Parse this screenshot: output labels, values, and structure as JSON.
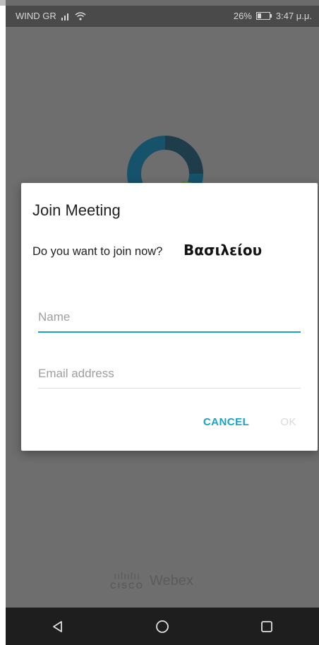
{
  "status_bar": {
    "carrier": "WIND GR",
    "battery": "26%",
    "time": "3:47 μ.μ."
  },
  "dialog": {
    "title": "Join Meeting",
    "message": "Do you want to join now?",
    "meeting_name": "Βασιλείου",
    "name_placeholder": "Name",
    "email_placeholder": "Email address",
    "cancel_label": "CANCEL",
    "ok_label": "OK"
  },
  "brand": {
    "cisco_bars": "ıılıılıı",
    "cisco": "CISCO",
    "webex": "Webex"
  },
  "colors": {
    "accent": "#1aa1c6",
    "logo_dark": "#17526b",
    "logo_teal": "#2f8bb0",
    "logo_green": "#6aa84f"
  },
  "icons": {
    "signal": "signal-icon",
    "wifi": "wifi-icon",
    "battery": "battery-icon",
    "back": "back-triangle-icon",
    "home": "home-circle-icon",
    "recents": "recents-square-icon"
  }
}
